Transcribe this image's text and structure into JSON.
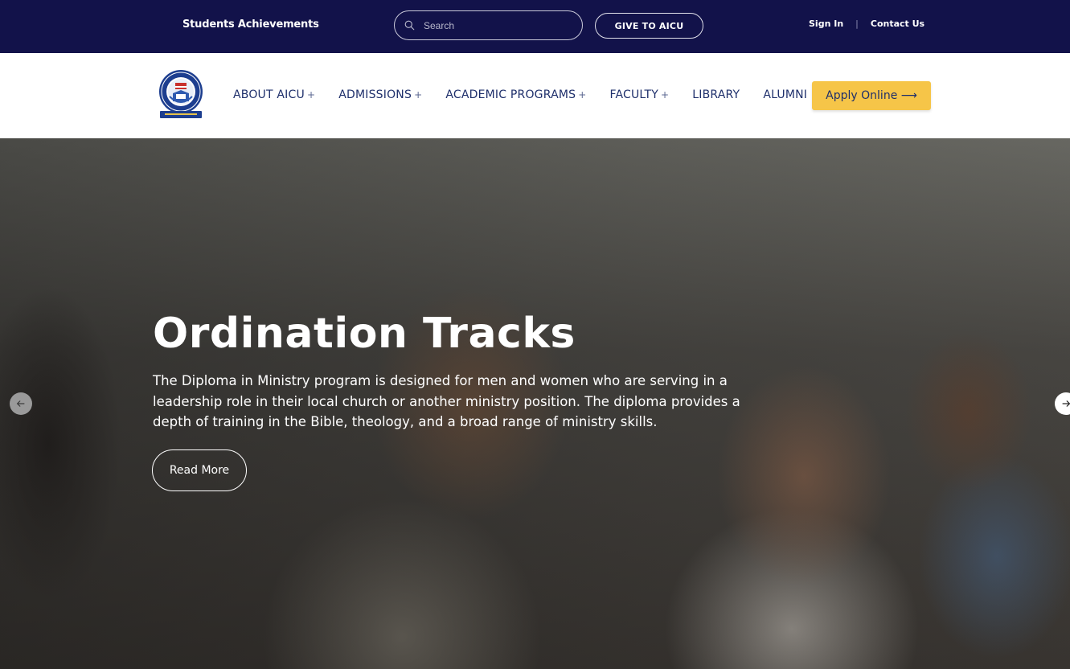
{
  "topbar": {
    "achievements": "Students Achievements",
    "search_placeholder": "Search",
    "give_label": "GIVE TO AICU",
    "sign_in": "Sign In",
    "separator": "|",
    "contact": "Contact Us"
  },
  "nav": {
    "items": [
      {
        "label": "ABOUT AICU",
        "plus": "+"
      },
      {
        "label": "ADMISSIONS",
        "plus": "+"
      },
      {
        "label": "ACADEMIC PROGRAMS",
        "plus": "+"
      },
      {
        "label": "FACULTY",
        "plus": "+"
      },
      {
        "label": "LIBRARY",
        "plus": ""
      },
      {
        "label": "ALUMNI",
        "plus": ""
      }
    ],
    "apply_label": "Apply Online ⟶"
  },
  "hero": {
    "title": "Ordination Tracks",
    "description": "The Diploma in Ministry program is designed for men and women who are serving in a leadership role in their local church or another ministry position. The diploma provides a depth of training in the Bible, theology, and a broad range of ministry skills.",
    "read_more": "Read More"
  },
  "colors": {
    "topbar_bg": "#12124a",
    "nav_text": "#1e2f6b",
    "apply_bg": "#f6c548"
  }
}
